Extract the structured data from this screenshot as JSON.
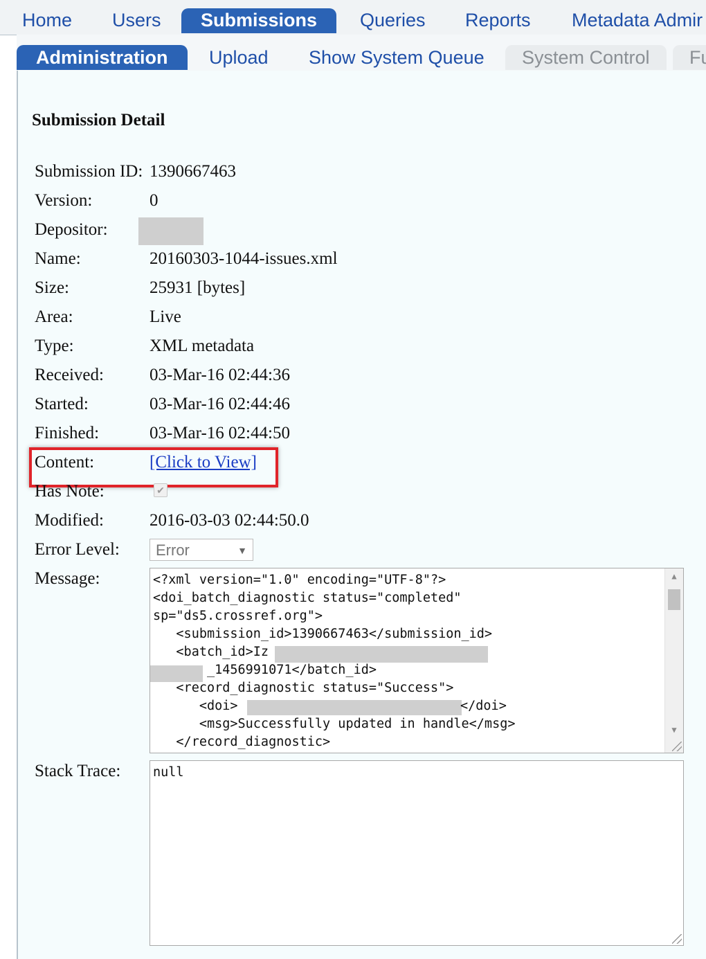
{
  "nav": {
    "top_tabs": [
      {
        "label": "Home",
        "active": false
      },
      {
        "label": "Users",
        "active": false
      },
      {
        "label": "Submissions",
        "active": true
      },
      {
        "label": "Queries",
        "active": false
      },
      {
        "label": "Reports",
        "active": false
      },
      {
        "label": "Metadata Admir",
        "active": false
      }
    ],
    "sub_tabs": [
      {
        "label": "Administration",
        "active": true
      },
      {
        "label": "Upload",
        "active": false
      },
      {
        "label": "Show System Queue",
        "active": false
      },
      {
        "label": "System Control",
        "disabled": true
      },
      {
        "label": "Fu",
        "disabled": true
      }
    ]
  },
  "detail": {
    "title": "Submission Detail",
    "fields": {
      "submission_id": {
        "label": "Submission ID:",
        "value": "1390667463"
      },
      "version": {
        "label": "Version:",
        "value": "0"
      },
      "depositor": {
        "label": "Depositor:",
        "value": ""
      },
      "name": {
        "label": "Name:",
        "value": "20160303-1044-issues.xml"
      },
      "size": {
        "label": "Size:",
        "value": "25931 [bytes]"
      },
      "area": {
        "label": "Area:",
        "value": "Live"
      },
      "type": {
        "label": "Type:",
        "value": "XML metadata"
      },
      "received": {
        "label": "Received:",
        "value": "03-Mar-16 02:44:36"
      },
      "started": {
        "label": "Started:",
        "value": "03-Mar-16 02:44:46"
      },
      "finished": {
        "label": "Finished:",
        "value": "03-Mar-16 02:44:50"
      },
      "content": {
        "label": "Content:",
        "link": "[Click to View]"
      },
      "has_note": {
        "label": "Has Note:",
        "checked": true
      },
      "modified": {
        "label": "Modified:",
        "value": "2016-03-03 02:44:50.0"
      },
      "error_level": {
        "label": "Error Level:",
        "selected": "Error"
      },
      "message": {
        "label": "Message:"
      },
      "stack_trace": {
        "label": "Stack Trace:",
        "value": "null"
      }
    },
    "message_lines": [
      "<?xml version=\"1.0\" encoding=\"UTF-8\"?>",
      "<doi_batch_diagnostic status=\"completed\"",
      "sp=\"ds5.crossref.org\">",
      "   <submission_id>1390667463</submission_id>",
      "   <batch_id>Iz",
      "       _1456991071</batch_id>",
      "   <record_diagnostic status=\"Success\">",
      "      <doi>",
      "      <msg>Successfully updated in handle</msg>",
      "   </record_diagnostic>"
    ],
    "message_line_tail": "</doi>"
  },
  "colors": {
    "tab_active": "#2b63b5",
    "link": "#1a3cc4",
    "highlight": "#e0242a",
    "panel_bg": "#f5fcfd"
  },
  "icons": {
    "select_arrow": "chevron-down-icon",
    "scroll_up": "arrow-up-icon",
    "scroll_down": "arrow-down-icon",
    "resize": "resize-grip-icon"
  }
}
